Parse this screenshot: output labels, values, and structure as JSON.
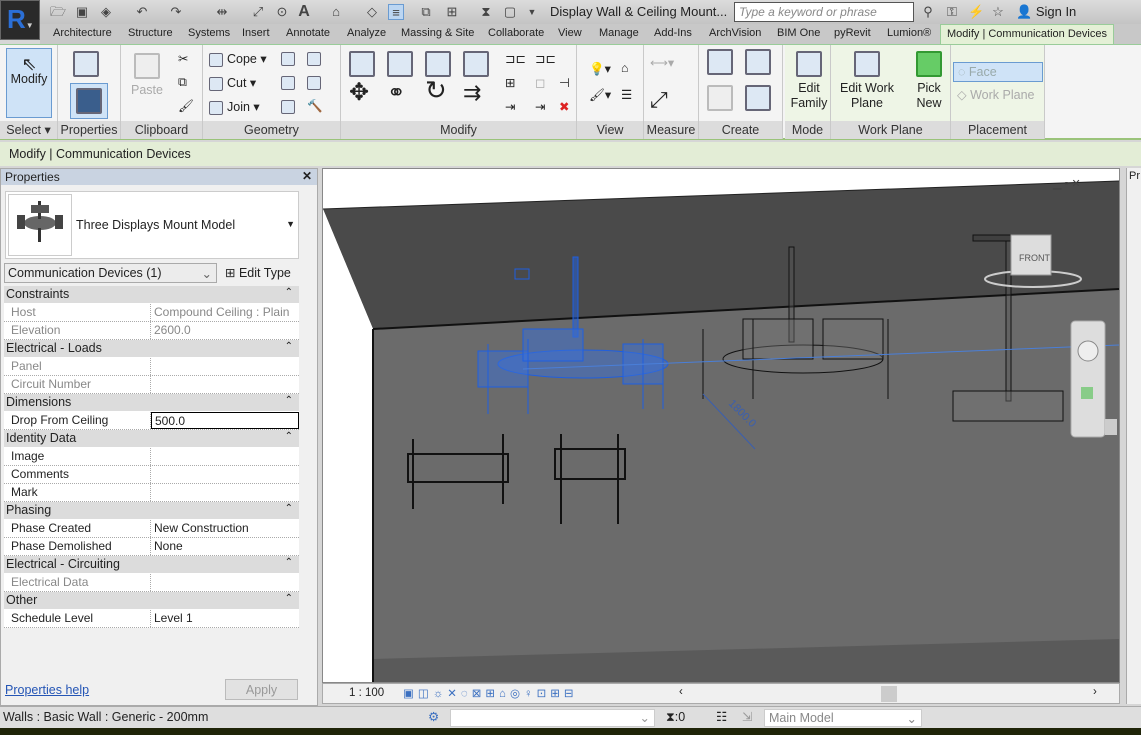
{
  "app": {
    "title": "Display Wall & Ceiling Mount...",
    "search_placeholder": "Type a keyword or phrase",
    "sign_in": "Sign In",
    "logo": "R"
  },
  "tabs": [
    "Architecture",
    "Structure",
    "Systems",
    "Insert",
    "Annotate",
    "Analyze",
    "Massing & Site",
    "Collaborate",
    "View",
    "Manage",
    "Add-Ins",
    "ArchVision",
    "BIM One",
    "pyRevit",
    "Lumion®"
  ],
  "active_tab": "Modify | Communication Devices",
  "ribbon": {
    "select": {
      "button": "Modify",
      "label": "Select"
    },
    "properties": {
      "label": "Properties"
    },
    "clipboard": {
      "paste": "Paste",
      "label": "Clipboard"
    },
    "geometry": {
      "cope": "Cope",
      "cut": "Cut",
      "join": "Join",
      "label": "Geometry"
    },
    "modify": {
      "label": "Modify"
    },
    "view": {
      "label": "View"
    },
    "measure": {
      "label": "Measure"
    },
    "create": {
      "label": "Create"
    },
    "mode": {
      "edit_family": "Edit Family",
      "label": "Mode"
    },
    "work_plane": {
      "edit_work_plane": "Edit Work Plane",
      "pick_new": "Pick New",
      "label": "Work Plane"
    },
    "placement": {
      "face": "Face",
      "work_plane": "Work Plane",
      "label": "Placement"
    }
  },
  "options_bar": "Modify | Communication Devices",
  "properties": {
    "title": "Properties",
    "type_name": "Three Displays Mount Model",
    "category": "Communication Devices (1)",
    "edit_type": "Edit Type",
    "groups": [
      {
        "name": "Constraints",
        "rows": [
          {
            "k": "Host",
            "v": "Compound Ceiling : Plain",
            "ro": true
          },
          {
            "k": "Elevation",
            "v": "2600.0",
            "ro": true
          }
        ]
      },
      {
        "name": "Electrical - Loads",
        "rows": [
          {
            "k": "Panel",
            "v": "",
            "ro": true
          },
          {
            "k": "Circuit Number",
            "v": "",
            "ro": true
          }
        ]
      },
      {
        "name": "Dimensions",
        "rows": [
          {
            "k": "Drop From Ceiling",
            "v": "500.0",
            "edit": true
          }
        ]
      },
      {
        "name": "Identity Data",
        "rows": [
          {
            "k": "Image",
            "v": ""
          },
          {
            "k": "Comments",
            "v": ""
          },
          {
            "k": "Mark",
            "v": ""
          }
        ]
      },
      {
        "name": "Phasing",
        "rows": [
          {
            "k": "Phase Created",
            "v": "New Construction"
          },
          {
            "k": "Phase Demolished",
            "v": "None"
          }
        ]
      },
      {
        "name": "Electrical - Circuiting",
        "rows": [
          {
            "k": "Electrical Data",
            "v": "",
            "ro": true
          }
        ]
      },
      {
        "name": "Other",
        "rows": [
          {
            "k": "Schedule Level",
            "v": "Level 1"
          }
        ]
      }
    ],
    "help": "Properties help",
    "apply": "Apply"
  },
  "view": {
    "scale": "1 : 100",
    "dimension": "1800.0",
    "viewcube_label": "FRONT",
    "right_panel_label": "Pr"
  },
  "status": {
    "selection": "Walls : Basic Wall : Generic - 200mm",
    "filter_count": ":0",
    "workset": "Main Model"
  },
  "colors": {
    "selection": "#1f5fe0",
    "highlight": "#f5f53a",
    "context_tab": "#e4f0d6"
  }
}
